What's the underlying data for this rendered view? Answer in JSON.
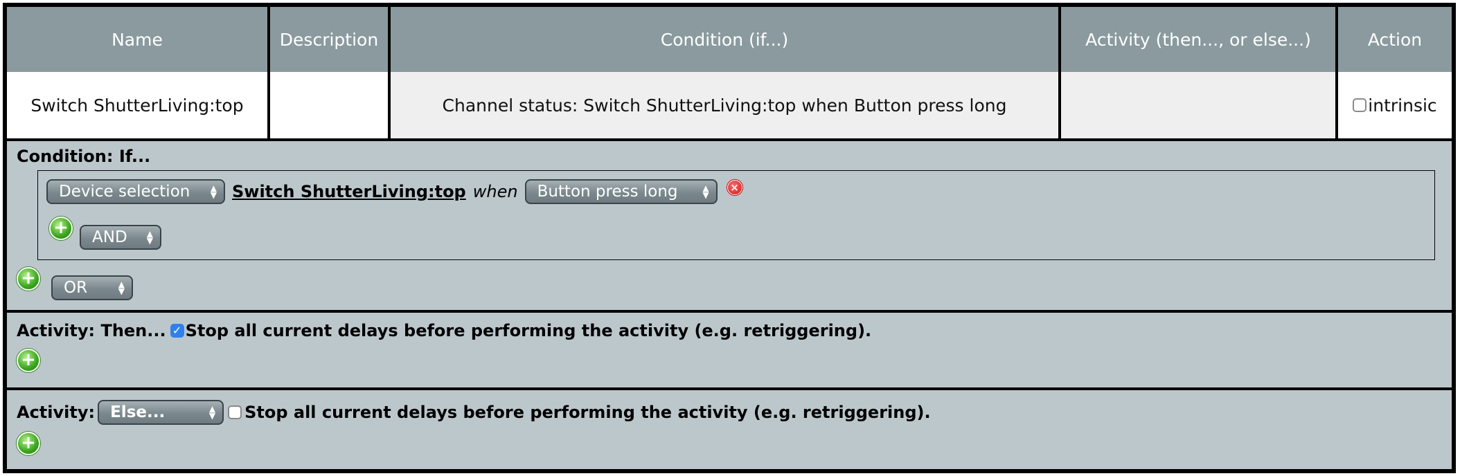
{
  "table": {
    "headers": [
      "Name",
      "Description",
      "Condition (if...)",
      "Activity (then..., or else...)",
      "Action"
    ],
    "row": {
      "name": "Switch ShutterLiving:top",
      "description": "",
      "condition": "Channel status: Switch ShutterLiving:top when Button press long",
      "activity": "",
      "action_checkbox_label": "intrinsic",
      "action_checked": false
    }
  },
  "condition_panel": {
    "title": "Condition: If...",
    "device_select": "Device selection",
    "device_name": "Switch ShutterLiving:top",
    "when_text": "when",
    "trigger_select": "Button press long",
    "and_select": "AND",
    "or_select": "OR"
  },
  "then_panel": {
    "title": "Activity: Then...",
    "stop_delays_checked": true,
    "stop_delays_label": "Stop all current delays before performing the activity (e.g. retriggering)."
  },
  "else_panel": {
    "title": "Activity:",
    "else_select": "Else...",
    "stop_delays_checked": false,
    "stop_delays_label": "Stop all current delays before performing the activity (e.g. retriggering)."
  },
  "colors": {
    "header_bg": "#8a9a9e",
    "panel_bg": "#bcc7cc",
    "add_icon": "#3aa51e",
    "delete_icon": "#d01818",
    "checkbox_checked": "#2f80ed"
  },
  "icons": [
    "add-icon",
    "delete-icon",
    "select-arrows-icon"
  ]
}
